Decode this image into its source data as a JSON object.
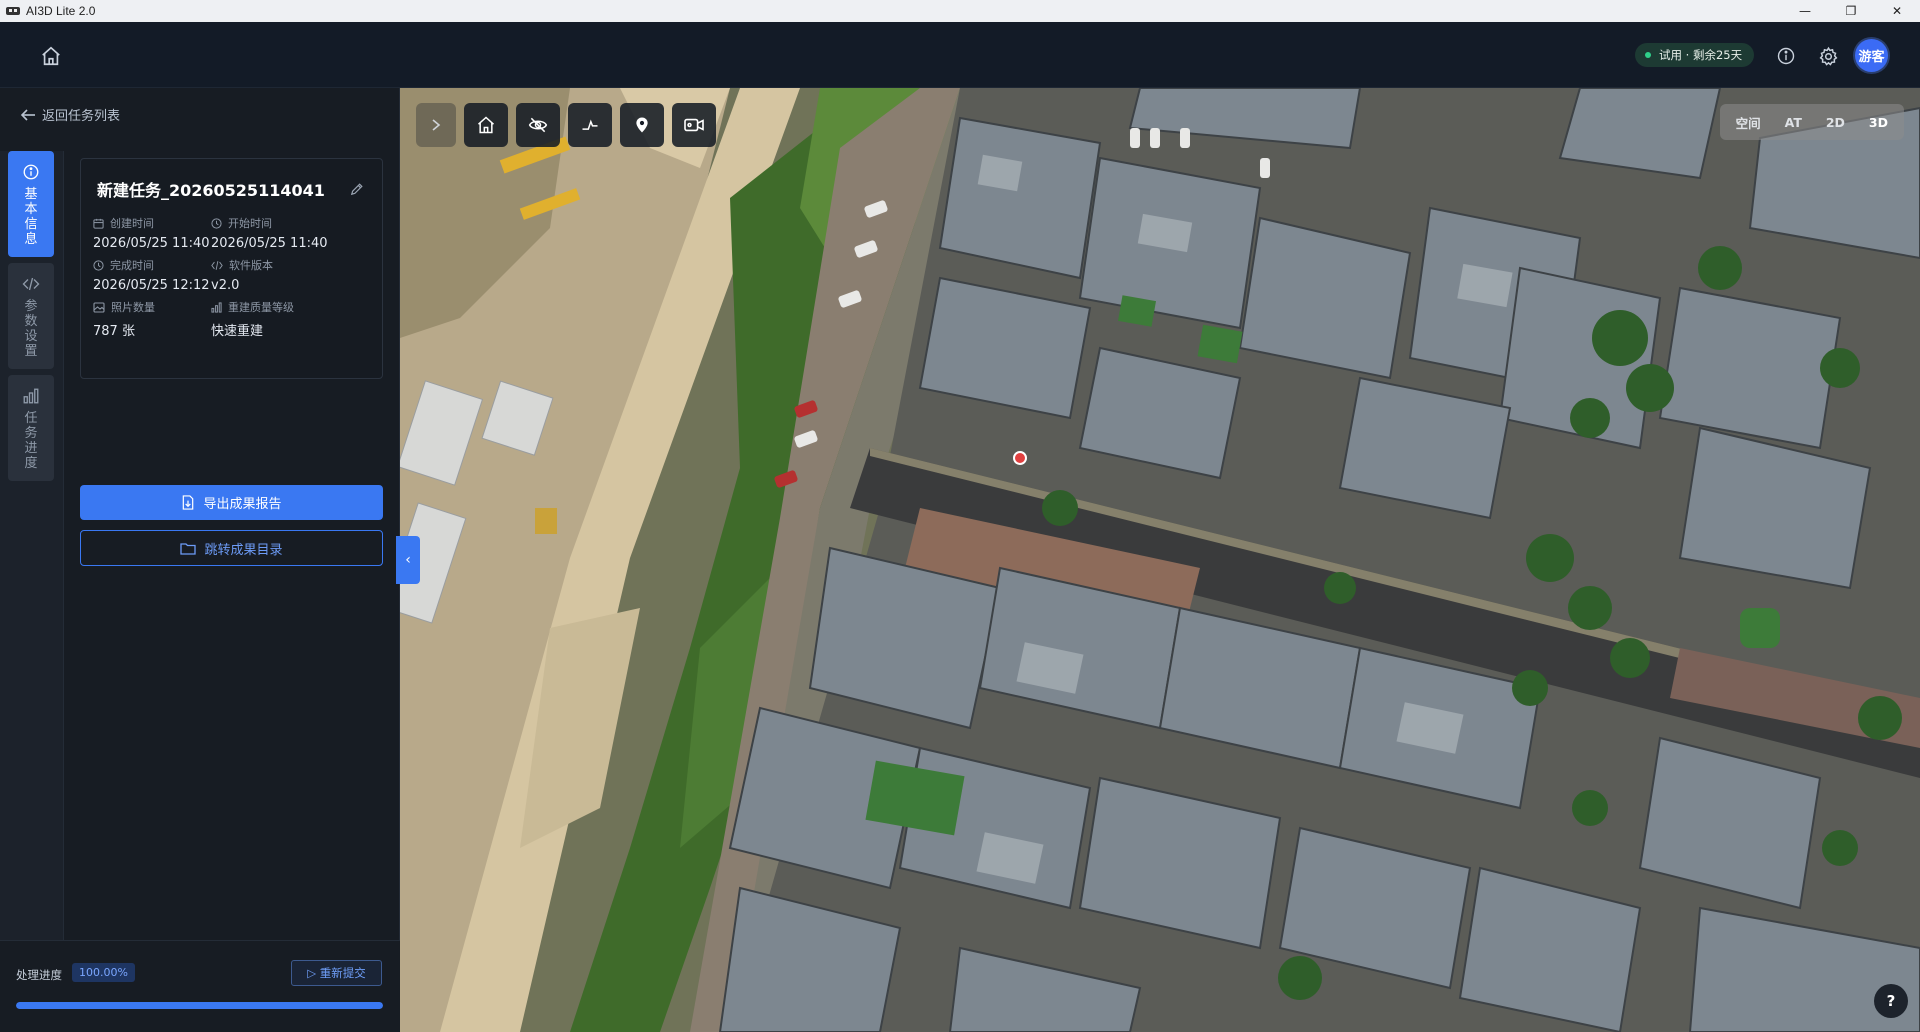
{
  "window": {
    "title": "AI3D Lite 2.0",
    "controls": {
      "minimize": "—",
      "maximize": "❐",
      "close": "✕"
    }
  },
  "header": {
    "trial_badge": "试用 · 剩余25天",
    "avatar_label": "游客",
    "icons": [
      "home-icon",
      "info-icon",
      "gear-icon"
    ]
  },
  "sidebar": {
    "back_label": "返回任务列表",
    "tabs": [
      {
        "label": "基本信息",
        "icon": "info-circle-icon",
        "active": true
      },
      {
        "label": "参数设置",
        "icon": "code-icon",
        "active": false
      },
      {
        "label": "任务进度",
        "icon": "bar-chart-icon",
        "active": false
      }
    ]
  },
  "task": {
    "name": "新建任务_20260525114041",
    "fields": [
      {
        "label": "创建时间",
        "value": "2026/05/25 11:40",
        "icon": "calendar-icon"
      },
      {
        "label": "开始时间",
        "value": "2026/05/25 11:40",
        "icon": "clock-icon"
      },
      {
        "label": "完成时间",
        "value": "2026/05/25 12:12",
        "icon": "clock-icon"
      },
      {
        "label": "软件版本",
        "value": "v2.0",
        "icon": "code-icon"
      },
      {
        "label": "照片数量",
        "value": "787 张",
        "icon": "image-icon"
      },
      {
        "label": "重建质量等级",
        "value": "快速重建",
        "icon": "signal-icon"
      }
    ],
    "export_report_label": "导出成果报告",
    "open_output_label": "跳转成果目录"
  },
  "progress": {
    "label": "处理进度",
    "percent_text": "100.00%",
    "fraction": 1.0,
    "resubmit_label": "▷ 重新提交"
  },
  "viewer": {
    "tools": [
      "home-view-icon",
      "eye-off-icon",
      "measure-icon",
      "location-pin-icon",
      "video-camera-icon"
    ],
    "modes": [
      {
        "label": "空间",
        "active": false
      },
      {
        "label": "AT",
        "active": false
      },
      {
        "label": "2D",
        "active": false
      },
      {
        "label": "3D",
        "active": true
      }
    ],
    "help_label": "?",
    "collapse_label": "‹"
  },
  "colors": {
    "accent": "#3a78f2",
    "header_bg": "#131b27",
    "panel_bg": "#171c23",
    "trial_dot": "#2fd08a"
  }
}
